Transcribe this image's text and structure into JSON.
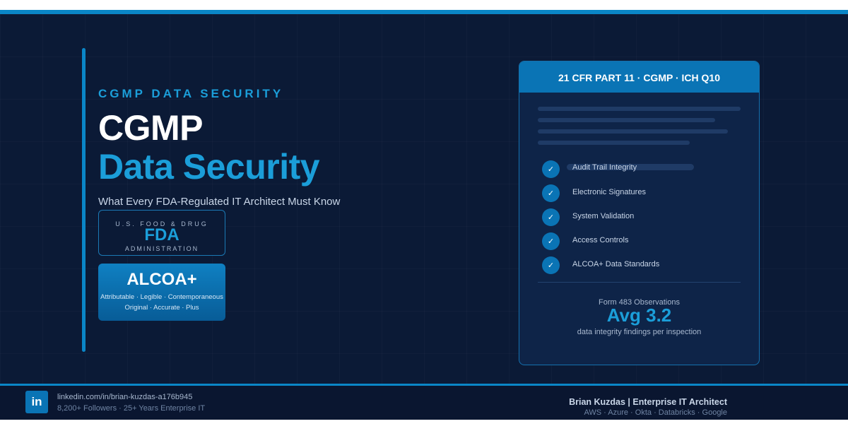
{
  "hero": {
    "kicker": "CGMP DATA SECURITY",
    "title_line1": "CGMP",
    "title_line2": "Data Security",
    "subtitle": "What Every FDA-Regulated IT Architect Must Know"
  },
  "fda_badge": {
    "top": "U.S. FOOD & DRUG",
    "mark": "FDA",
    "bottom": "ADMINISTRATION"
  },
  "alcoa_badge": {
    "title": "ALCOA+",
    "line1": "Attributable · Legible · Contemporaneous",
    "line2": "Original · Accurate · Plus"
  },
  "panel": {
    "header": "21 CFR PART 11 · CGMP · ICH Q10",
    "items": [
      {
        "label": "Audit Trail Integrity",
        "icon": "check-icon"
      },
      {
        "label": "Electronic Signatures",
        "icon": "check-icon"
      },
      {
        "label": "System Validation",
        "icon": "check-icon"
      },
      {
        "label": "Access Controls",
        "icon": "check-icon"
      },
      {
        "label": "ALCOA+ Data Standards",
        "icon": "check-icon"
      }
    ],
    "metric_label": "Form 483 Observations",
    "metric_value": "Avg 3.2",
    "metric_note": "data integrity findings per inspection"
  },
  "footer": {
    "logo_text": "in",
    "profile_url": "linkedin.com/in/brian-kuzdas-a176b945",
    "profile_stats": "8,200+ Followers · 25+ Years Enterprise IT",
    "author": "Brian Kuzdas | Enterprise IT Architect",
    "stack": "AWS · Azure · Okta · Databricks · Google"
  },
  "colors": {
    "background": "#0b1a36",
    "accent": "#1b9ed9",
    "brand_blue": "#0a74b5",
    "panel": "#0e2448"
  }
}
